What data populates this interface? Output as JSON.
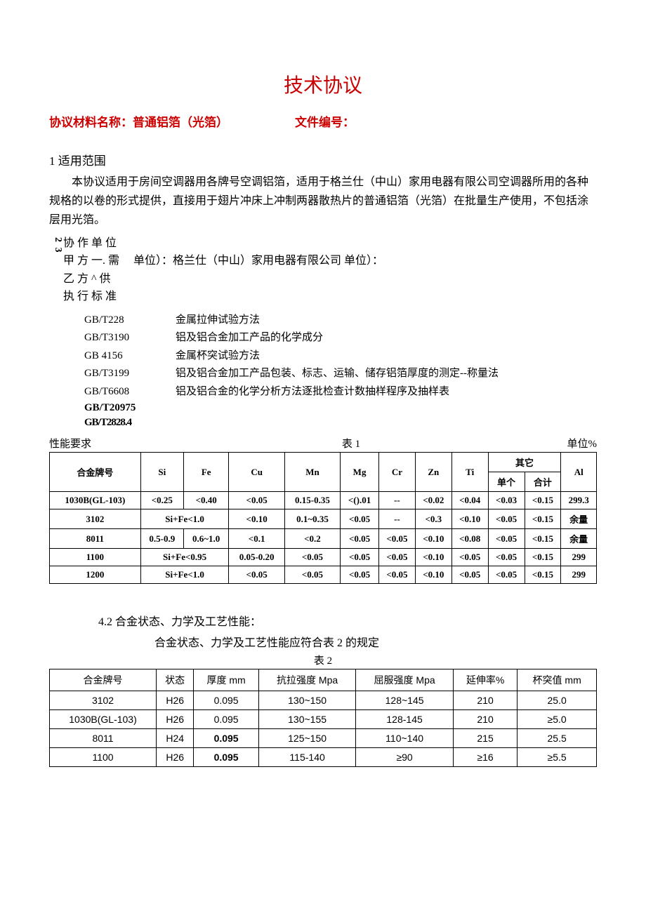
{
  "title": "技术协议",
  "header": {
    "left_label": "协议材料名称：",
    "left_value": "普通铝箔（光箔）",
    "right_label": "文件编号：",
    "right_value": ""
  },
  "sec1": {
    "heading": "1 适用范围",
    "para": "本协议适用于房间空调器用各牌号空调铝箔，适用于格兰仕（中山）家用电器有限公司空调器所用的各种规格的以卷的形式提供，直接用于翅片冲床上冲制两器散热片的普通铝箔（光箔）在批量生产使用，不包括涂层用光箔。"
  },
  "assoc": {
    "vnum": "2  3",
    "l1": "协 作 单 位",
    "l2a": "甲",
    "l2b": "方 一. 需",
    "l2c": "单位）：格兰仕（中山）家用电器有限公司 单位）：",
    "l3a": "乙",
    "l3b": "方 ^ 供",
    "l4a": "执",
    "l4b": "行 标 准"
  },
  "standards": [
    {
      "code": "GB/T228",
      "desc": "金属拉伸试验方法"
    },
    {
      "code": "GB/T3190",
      "desc": "铝及铝合金加工产品的化学成分"
    },
    {
      "code": "GB 4156",
      "desc": "金属杯突试验方法"
    },
    {
      "code": "GB/T3199",
      "desc": "铝及铝合金加工产品包装、标志、运输、储存铝箔厚度的测定--称量法"
    },
    {
      "code": "GB/T6608",
      "desc": "铝及铝合金的化学分析方法逐批检查计数抽样程序及抽样表"
    }
  ],
  "std_tail1": "GB/T20975",
  "std_tail2": "GB/T2828.4",
  "table1": {
    "title_left": "性能要求",
    "title_mid": "表 1",
    "title_right": "单位%",
    "headers": {
      "alloy": "合金牌号",
      "si": "Si",
      "fe": "Fe",
      "cu": "Cu",
      "mn": "Mn",
      "mg": "Mg",
      "cr": "Cr",
      "zn": "Zn",
      "ti": "Ti",
      "other": "其它",
      "other_single": "单个",
      "other_total": "合计",
      "al": "Al"
    },
    "chart_data": {
      "type": "table",
      "rows": [
        {
          "alloy": "1030B(GL-103)",
          "si": "<0.25",
          "fe": "<0.40",
          "cu": "<0.05",
          "mn": "0.15-0.35",
          "mg": "<().01",
          "cr": "--",
          "zn": "<0.02",
          "ti": "<0.04",
          "os": "<0.03",
          "ot": "<0.15",
          "al": "299.3"
        },
        {
          "alloy": "3102",
          "sife": "Si+Fe<1.0",
          "cu": "<0.10",
          "mn": "0.1~0.35",
          "mg": "<0.05",
          "cr": "--",
          "zn": "<0.3",
          "ti": "<0.10",
          "os": "<0.05",
          "ot": "<0.15",
          "al": "余量"
        },
        {
          "alloy": "8011",
          "si": "0.5-0.9",
          "fe": "0.6~1.0",
          "cu": "<0.1",
          "mn": "<0.2",
          "mg": "<0.05",
          "cr": "<0.05",
          "zn": "<0.10",
          "ti": "<0.08",
          "os": "<0.05",
          "ot": "<0.15",
          "al": "余量"
        },
        {
          "alloy": "1100",
          "sife": "Si+Fe<0.95",
          "cu": "0.05-0.20",
          "mn": "<0.05",
          "mg": "<0.05",
          "cr": "<0.05",
          "zn": "<0.10",
          "ti": "<0.05",
          "os": "<0.05",
          "ot": "<0.15",
          "al": "299"
        },
        {
          "alloy": "1200",
          "sife": "Si+Fe<1.0",
          "cu": "<0.05",
          "mn": "<0.05",
          "mg": "<0.05",
          "cr": "<0.05",
          "zn": "<0.10",
          "ti": "<0.05",
          "os": "<0.05",
          "ot": "<0.15",
          "al": "299"
        }
      ]
    }
  },
  "sec42": {
    "heading": "4.2 合金状态、力学及工艺性能：",
    "desc": "合金状态、力学及工艺性能应符合表 2 的规定",
    "caption": "表 2"
  },
  "table2": {
    "headers": {
      "alloy": "合金牌号",
      "state": "状态",
      "thick": "厚度 mm",
      "tensile": "抗拉强度 Mpa",
      "yield": "屈服强度 Mpa",
      "elong": "延伸率%",
      "cup": "杯突值 mm"
    },
    "chart_data": {
      "type": "table",
      "rows": [
        {
          "alloy": "3102",
          "state": "H26",
          "thick": "0.095",
          "tensile": "130~150",
          "yield": "128~145",
          "elong": "210",
          "cup": "25.0"
        },
        {
          "alloy": "1030B(GL-103)",
          "state": "H26",
          "thick": "0.095",
          "tensile": "130~155",
          "yield": "128-145",
          "elong": "210",
          "cup": "≥5.0"
        },
        {
          "alloy": "8011",
          "state": "H24",
          "thick": "0.095",
          "tensile": "125~150",
          "yield": "110~140",
          "elong": "215",
          "cup": "25.5"
        },
        {
          "alloy": "1100",
          "state": "H26",
          "thick": "0.095",
          "tensile": "115-140",
          "yield": "≥90",
          "elong": "≥16",
          "cup": "≥5.5"
        }
      ]
    }
  }
}
